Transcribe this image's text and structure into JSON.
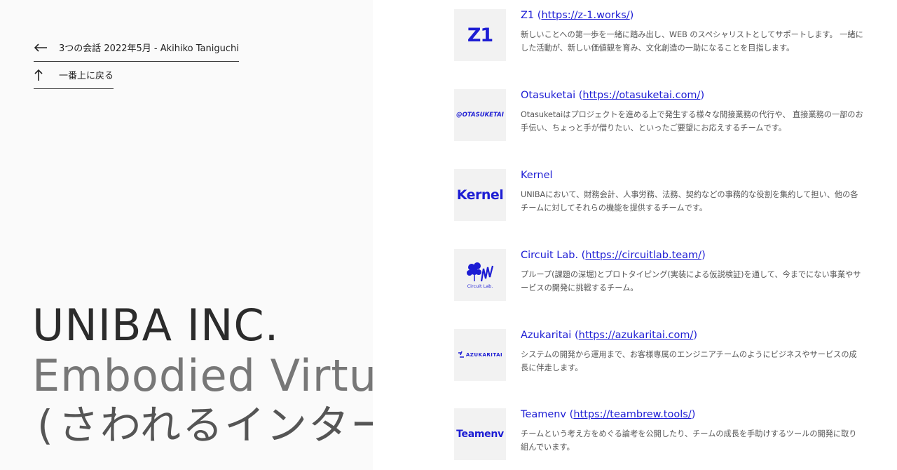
{
  "left": {
    "back_link": {
      "icon": "arrow-left-icon",
      "label": "3つの会話 2022年5月 - Akihiko Taniguchi"
    },
    "top_link": {
      "icon": "arrow-up-icon",
      "label": "一番上に戻る"
    },
    "hero": {
      "line1": "UNIBA INC.",
      "line2": "Embodied Virtu",
      "line3": "(さわれるインター:"
    }
  },
  "teams": [
    {
      "name": "Z1",
      "url": "https://z-1.works/",
      "logo_text": "Z1",
      "description": "新しいことへの第一歩を一緒に踏み出し、WEB のスペシャリストとしてサポートします。 一緒にした活動が、新しい価値観を育み、文化創造の一助になることを目指します。"
    },
    {
      "name": "Otasuketai",
      "url": "https://otasuketai.com/",
      "logo_text": "@OTASUKETAI",
      "description": "Otasuketaiはプロジェクトを進める上で発生する様々な間接業務の代行や、 直接業務の一部のお手伝い、ちょっと手が借りたい、といったご要望にお応えするチームです。"
    },
    {
      "name": "Kernel",
      "url": "",
      "logo_text": "Kernel",
      "description": "UNIBAにおいて、財務会計、人事労務、法務、契約などの事務的な役割を集約して担い、他の各チームに対してそれらの機能を提供するチームです。"
    },
    {
      "name": "Circuit Lab.",
      "url": "https://circuitlab.team/",
      "logo_text": "Circuit Lab.",
      "description": "プループ(課題の深堀)とプロトタイピング(実装による仮説検証)を通して、今までにない事業やサービスの開発に挑戦するチーム。"
    },
    {
      "name": "Azukaritai",
      "url": "https://azukaritai.com/",
      "logo_text": "AZUKARITAI",
      "description": "システムの開発から運用まで、お客様専属のエンジニアチームのようにビジネスやサービスの成長に伴走します。"
    },
    {
      "name": "Teamenv",
      "url": "https://teambrew.tools/",
      "logo_text": "Teamenv",
      "description": "チームという考え方をめぐる論考を公開したり、チームの成長を手助けするツールの開発に取り組んでいます。"
    }
  ],
  "colors": {
    "accent": "#1d1dd4",
    "left_bg": "#fafafa",
    "logo_bg": "#f2f2f2"
  }
}
